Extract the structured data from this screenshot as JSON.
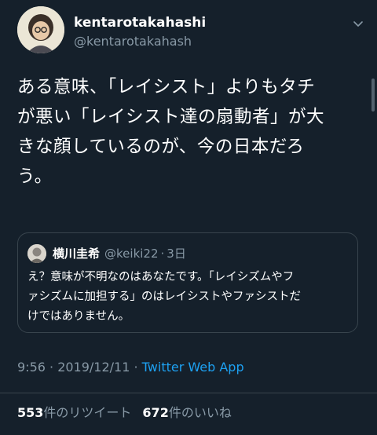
{
  "author": {
    "display_name": "kentarotakahashi",
    "handle": "@kentarotakahash"
  },
  "tweet": {
    "text": "ある意味、「レイシスト」よりもタチ\nが悪い「レイシスト達の扇動者」が大\nきな顔しているのが、今の日本だろ\nう。"
  },
  "quoted_tweet": {
    "display_name": "横川圭希",
    "handle": "@keiki22",
    "separator": "·",
    "time": "3日",
    "text": "え？意味が不明なのはあなたです。「レイシズムやフ\nァシズムに加担する」のはレイシストやファシストだ\nけではありません。"
  },
  "meta": {
    "timestamp": "9:56 · 2019/12/11 · ",
    "app": "Twitter Web App"
  },
  "stats": {
    "retweets_count": "553",
    "retweets_label": "件のリツイート",
    "likes_count": "672",
    "likes_label": "件のいいね"
  },
  "colors": {
    "background": "#15202b",
    "secondary_text": "#8899a6",
    "accent": "#1da1f2",
    "border": "#38444d"
  },
  "icons": {
    "chevron": "chevron-down-icon"
  }
}
